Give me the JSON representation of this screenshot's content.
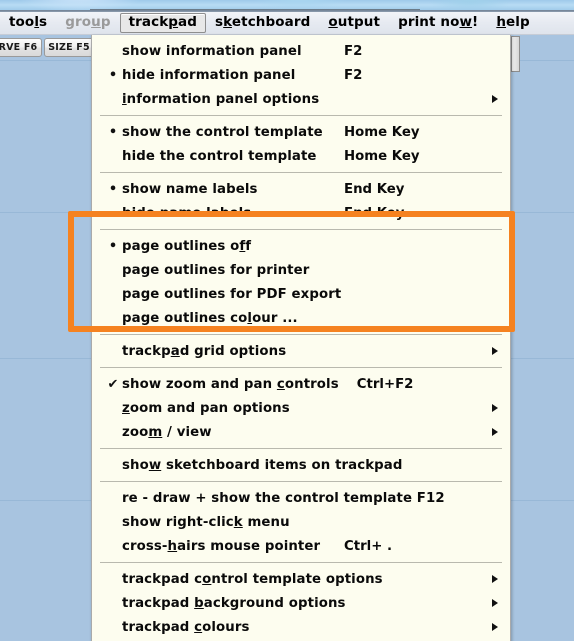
{
  "menubar": {
    "items": [
      {
        "label": "tools",
        "pre": "too",
        "mnemonic": "l",
        "post": "s",
        "state": "normal"
      },
      {
        "label": "group",
        "pre": "gro",
        "mnemonic": "u",
        "post": "p",
        "state": "disabled"
      },
      {
        "label": "trackpad",
        "pre": "track",
        "mnemonic": "p",
        "post": "ad",
        "state": "active"
      },
      {
        "label": "sketchboard",
        "pre": "s",
        "mnemonic": "k",
        "post": "etchboard",
        "state": "normal"
      },
      {
        "label": "output",
        "pre": "",
        "mnemonic": "o",
        "post": "utput",
        "state": "normal"
      },
      {
        "label": "print now!",
        "pre": "print no",
        "mnemonic": "w",
        "post": "!",
        "state": "normal"
      },
      {
        "label": "help",
        "pre": "",
        "mnemonic": "h",
        "post": "elp",
        "state": "normal"
      }
    ]
  },
  "toolbar": {
    "buttons": [
      {
        "label": "URVE F6",
        "name": "curve-button"
      },
      {
        "label": "SIZE F5",
        "name": "size-button"
      }
    ]
  },
  "dropdown": {
    "owner": "trackpad",
    "groups": [
      {
        "items": [
          {
            "mark": "",
            "pre": "show  information  panel",
            "mnemonic": "",
            "post": "",
            "accel": "F2",
            "submenu": false
          },
          {
            "mark": "•",
            "pre": "hide  information  panel",
            "mnemonic": "",
            "post": "",
            "accel": "F2",
            "submenu": false
          },
          {
            "mark": "",
            "pre": "",
            "mnemonic": "i",
            "post": "nformation  panel  options",
            "accel": "",
            "submenu": true
          }
        ]
      },
      {
        "items": [
          {
            "mark": "•",
            "pre": "show  the  control  template",
            "mnemonic": "",
            "post": "",
            "accel": "Home Key",
            "submenu": false
          },
          {
            "mark": "",
            "pre": "hide  the  control  template",
            "mnemonic": "",
            "post": "",
            "accel": "Home Key",
            "submenu": false
          }
        ]
      },
      {
        "items": [
          {
            "mark": "•",
            "pre": "show  name  labels",
            "mnemonic": "",
            "post": "",
            "accel": "End  Key",
            "submenu": false
          },
          {
            "mark": "",
            "pre": "hide  name  labels",
            "mnemonic": "",
            "post": "",
            "accel": "End  Key",
            "submenu": false
          }
        ]
      },
      {
        "highlighted": true,
        "items": [
          {
            "mark": "•",
            "pre": "page  outlines  o",
            "mnemonic": "f",
            "post": "f",
            "accel": "",
            "submenu": false
          },
          {
            "mark": "",
            "pre": "page  outlines  for  printer",
            "mnemonic": "",
            "post": "",
            "accel": "",
            "submenu": false
          },
          {
            "mark": "",
            "pre": "page  outlines  for  PDF  export",
            "mnemonic": "",
            "post": "",
            "accel": "",
            "submenu": false
          },
          {
            "mark": "",
            "pre": "page  outlines  co",
            "mnemonic": "l",
            "post": "our ...",
            "accel": "",
            "submenu": false
          }
        ]
      },
      {
        "items": [
          {
            "mark": "",
            "pre": "trackp",
            "mnemonic": "a",
            "post": "d  grid  options",
            "accel": "",
            "submenu": true
          }
        ]
      },
      {
        "items": [
          {
            "mark": "✔",
            "pre": "show  zoom  and  pan  ",
            "mnemonic": "c",
            "post": "ontrols",
            "accel": "Ctrl+F2",
            "submenu": false
          },
          {
            "mark": "",
            "pre": "",
            "mnemonic": "z",
            "post": "oom  and  pan  options",
            "accel": "",
            "submenu": true
          },
          {
            "mark": "",
            "pre": "zoo",
            "mnemonic": "m",
            "post": " / view",
            "accel": "",
            "submenu": true
          }
        ]
      },
      {
        "items": [
          {
            "mark": "",
            "pre": "sho",
            "mnemonic": "w",
            "post": "  sketchboard  items  on  trackpad",
            "accel": "",
            "submenu": false
          }
        ]
      },
      {
        "items": [
          {
            "mark": "",
            "pre": "re - draw  +  show  the  control  template  F12",
            "mnemonic": "",
            "post": "",
            "accel": "",
            "submenu": false
          },
          {
            "mark": "",
            "pre": "show  right-clic",
            "mnemonic": "k",
            "post": "  menu",
            "accel": "",
            "submenu": false
          },
          {
            "mark": "",
            "pre": "cross-",
            "mnemonic": "h",
            "post": "airs  mouse  pointer",
            "accel": "Ctrl+ .",
            "submenu": false
          }
        ]
      },
      {
        "items": [
          {
            "mark": "",
            "pre": "trackpad  c",
            "mnemonic": "o",
            "post": "ntrol  template  options",
            "accel": "",
            "submenu": true
          },
          {
            "mark": "",
            "pre": "trackpad  ",
            "mnemonic": "b",
            "post": "ackground  options",
            "accel": "",
            "submenu": true
          },
          {
            "mark": "",
            "pre": "trackpad  ",
            "mnemonic": "c",
            "post": "olours",
            "accel": "",
            "submenu": true
          }
        ]
      }
    ]
  },
  "annotation": {
    "highlight_color": "#f58220",
    "target_group_index": 3
  },
  "colors": {
    "canvas_background": "#a8c4e0",
    "menu_background": "#fdfdef",
    "grid_line": "#93b4d4",
    "highlight": "#f58220"
  },
  "canvas": {
    "horizontal_rules": [
      60,
      212,
      358,
      500
    ],
    "vertical_rules": [
      128,
      262,
      396
    ]
  }
}
